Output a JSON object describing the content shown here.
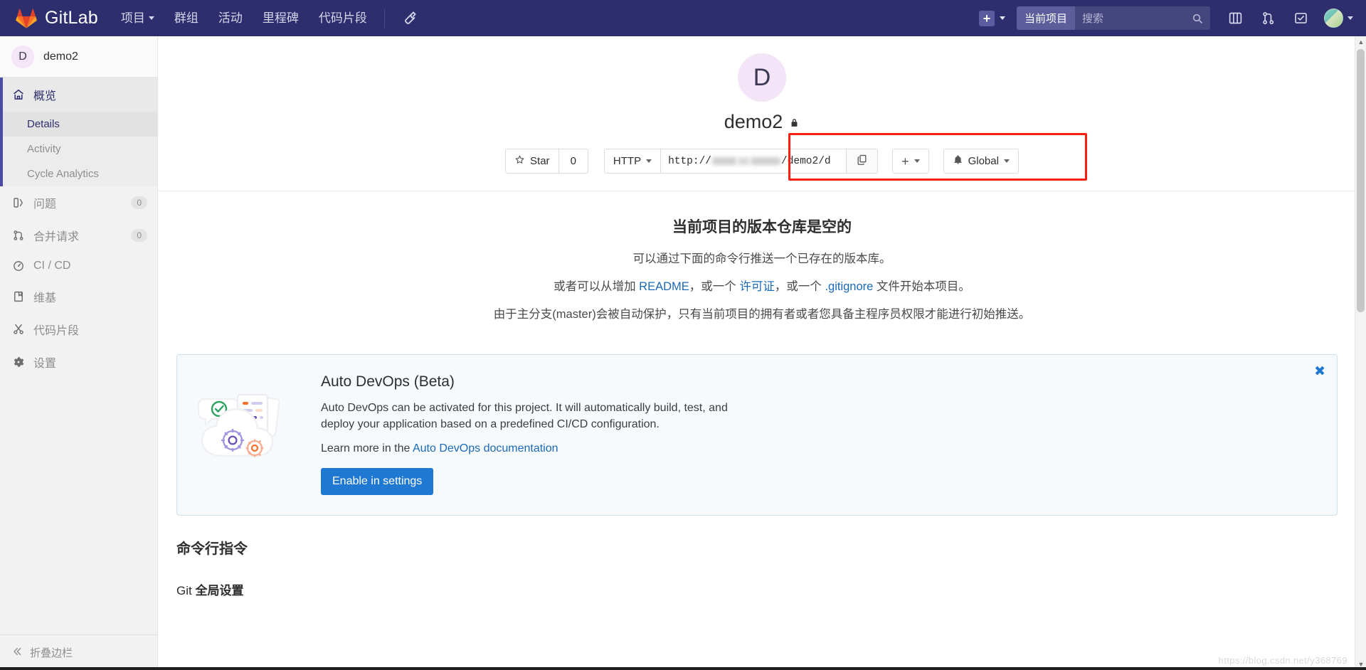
{
  "topnav": {
    "brand": "GitLab",
    "links": [
      {
        "label": "项目",
        "has_caret": true
      },
      {
        "label": "群组",
        "has_caret": false
      },
      {
        "label": "活动",
        "has_caret": false
      },
      {
        "label": "里程碑",
        "has_caret": false
      },
      {
        "label": "代码片段",
        "has_caret": false
      }
    ],
    "wrench_icon": "wrench-icon",
    "plus_icon": "plus-icon",
    "search": {
      "scope": "当前项目",
      "placeholder": "搜索"
    },
    "icons": [
      "issues-board-icon",
      "merge-request-icon",
      "todos-icon"
    ],
    "avatar_caret": "chevron-down-icon"
  },
  "sidebar": {
    "project": {
      "initial": "D",
      "name": "demo2"
    },
    "overview": {
      "label": "概览",
      "icon": "home-icon"
    },
    "sub_items": [
      {
        "label": "Details",
        "active": true
      },
      {
        "label": "Activity",
        "active": false
      },
      {
        "label": "Cycle Analytics",
        "active": false
      }
    ],
    "items": [
      {
        "label": "问题",
        "icon": "issues-icon",
        "badge": "0"
      },
      {
        "label": "合并请求",
        "icon": "merge-request-icon",
        "badge": "0"
      },
      {
        "label": "CI / CD",
        "icon": "pipeline-icon",
        "badge": ""
      },
      {
        "label": "维基",
        "icon": "book-icon",
        "badge": ""
      },
      {
        "label": "代码片段",
        "icon": "scissors-icon",
        "badge": ""
      },
      {
        "label": "设置",
        "icon": "gear-icon",
        "badge": ""
      }
    ],
    "collapse": {
      "label": "折叠边栏",
      "icon": "double-chevron-left-icon"
    }
  },
  "project_header": {
    "initial": "D",
    "title": "demo2",
    "visibility_icon": "lock-icon",
    "star_label": "Star",
    "star_icon": "star-icon",
    "star_count": "0",
    "protocol": "HTTP",
    "clone_url_prefix": "http://",
    "clone_url_suffix": "/demo2/d",
    "copy_icon": "copy-icon",
    "plus_label": "+",
    "notification_label": "Global",
    "bell_icon": "bell-icon"
  },
  "empty_repo": {
    "title": "当前项目的版本仓库是空的",
    "subtitle": "可以通过下面的命令行推送一个已存在的版本库。",
    "line_start": "或者可以从增加 ",
    "readme_link": "README",
    "line_mid1": "，或一个 ",
    "license_link": "许可证",
    "line_mid2": "，或一个 ",
    "gitignore_link": ".gitignore",
    "line_end": " 文件开始本项目。",
    "note": "由于主分支(master)会被自动保护，只有当前项目的拥有者或者您具备主程序员权限才能进行初始推送。"
  },
  "auto_devops": {
    "title": "Auto DevOps (Beta)",
    "description": "Auto DevOps can be activated for this project. It will automatically build, test, and deploy your application based on a predefined CI/CD configuration.",
    "learn_prefix": "Learn more in the ",
    "learn_link": "Auto DevOps documentation",
    "button": "Enable in settings",
    "close_icon": "close-icon"
  },
  "command_line": {
    "heading": "命令行指令",
    "git_global_bold": "全局设置",
    "git_global_prefix": "Git "
  },
  "watermark": "https://blog.csdn.net/y368769",
  "colors": {
    "nav_bg": "#2e2e6f",
    "accent": "#1f78d1",
    "link": "#1b69b6",
    "highlight_box": "#fb1f12",
    "sidebar_bg": "#f2f2f2"
  }
}
